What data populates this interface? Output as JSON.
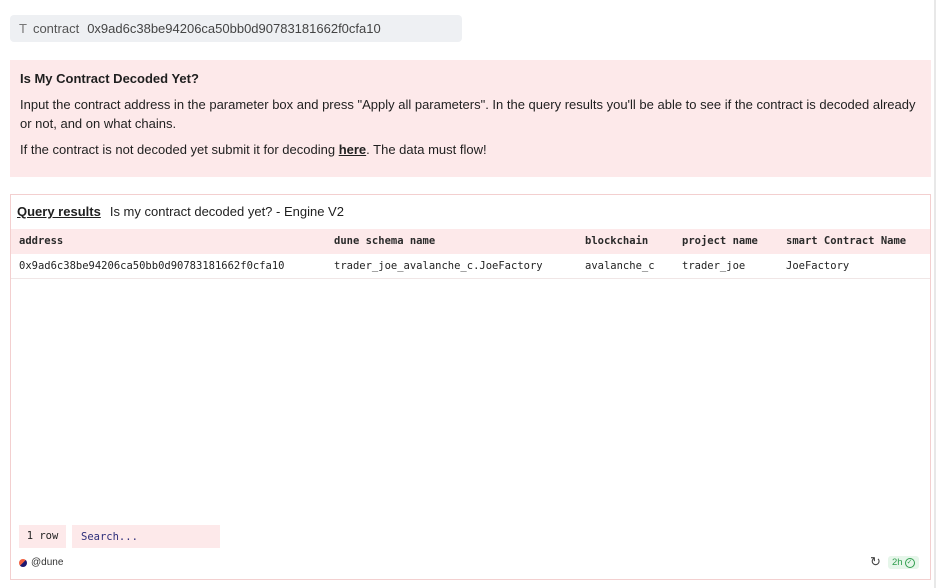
{
  "parameter": {
    "icon": "text-type-icon",
    "name": "contract",
    "value": "0x9ad6c38be94206ca50bb0d90783181662f0cfa10"
  },
  "info": {
    "title": "Is My Contract Decoded Yet?",
    "paragraph1": "Input the contract address in the parameter box and press \"Apply all parameters\". In the query results you'll be able to see if the contract is decoded already or not, and on what chains.",
    "paragraph2_before": "If the contract is not decoded yet submit it for decoding ",
    "link_text": "here",
    "paragraph2_after": ". The data must flow!"
  },
  "results": {
    "tab_label": "Query results",
    "query_title": "Is my contract decoded yet? - Engine V2",
    "columns": [
      "address",
      "dune schema name",
      "blockchain",
      "project name",
      "smart Contract Name"
    ],
    "rows": [
      [
        "0x9ad6c38be94206ca50bb0d90783181662f0cfa10",
        "trader_joe_avalanche_c.JoeFactory",
        "avalanche_c",
        "trader_joe",
        "JoeFactory"
      ]
    ],
    "row_count": "1 row",
    "search_placeholder": "Search..."
  },
  "footer": {
    "author": "@dune",
    "refresh_icon": "refresh-icon",
    "age": "2h",
    "status_icon": "check-circle-icon"
  },
  "colors": {
    "accent_bg": "#fde9ea",
    "border": "#f3cfcf",
    "success": "#2f9e4d"
  }
}
